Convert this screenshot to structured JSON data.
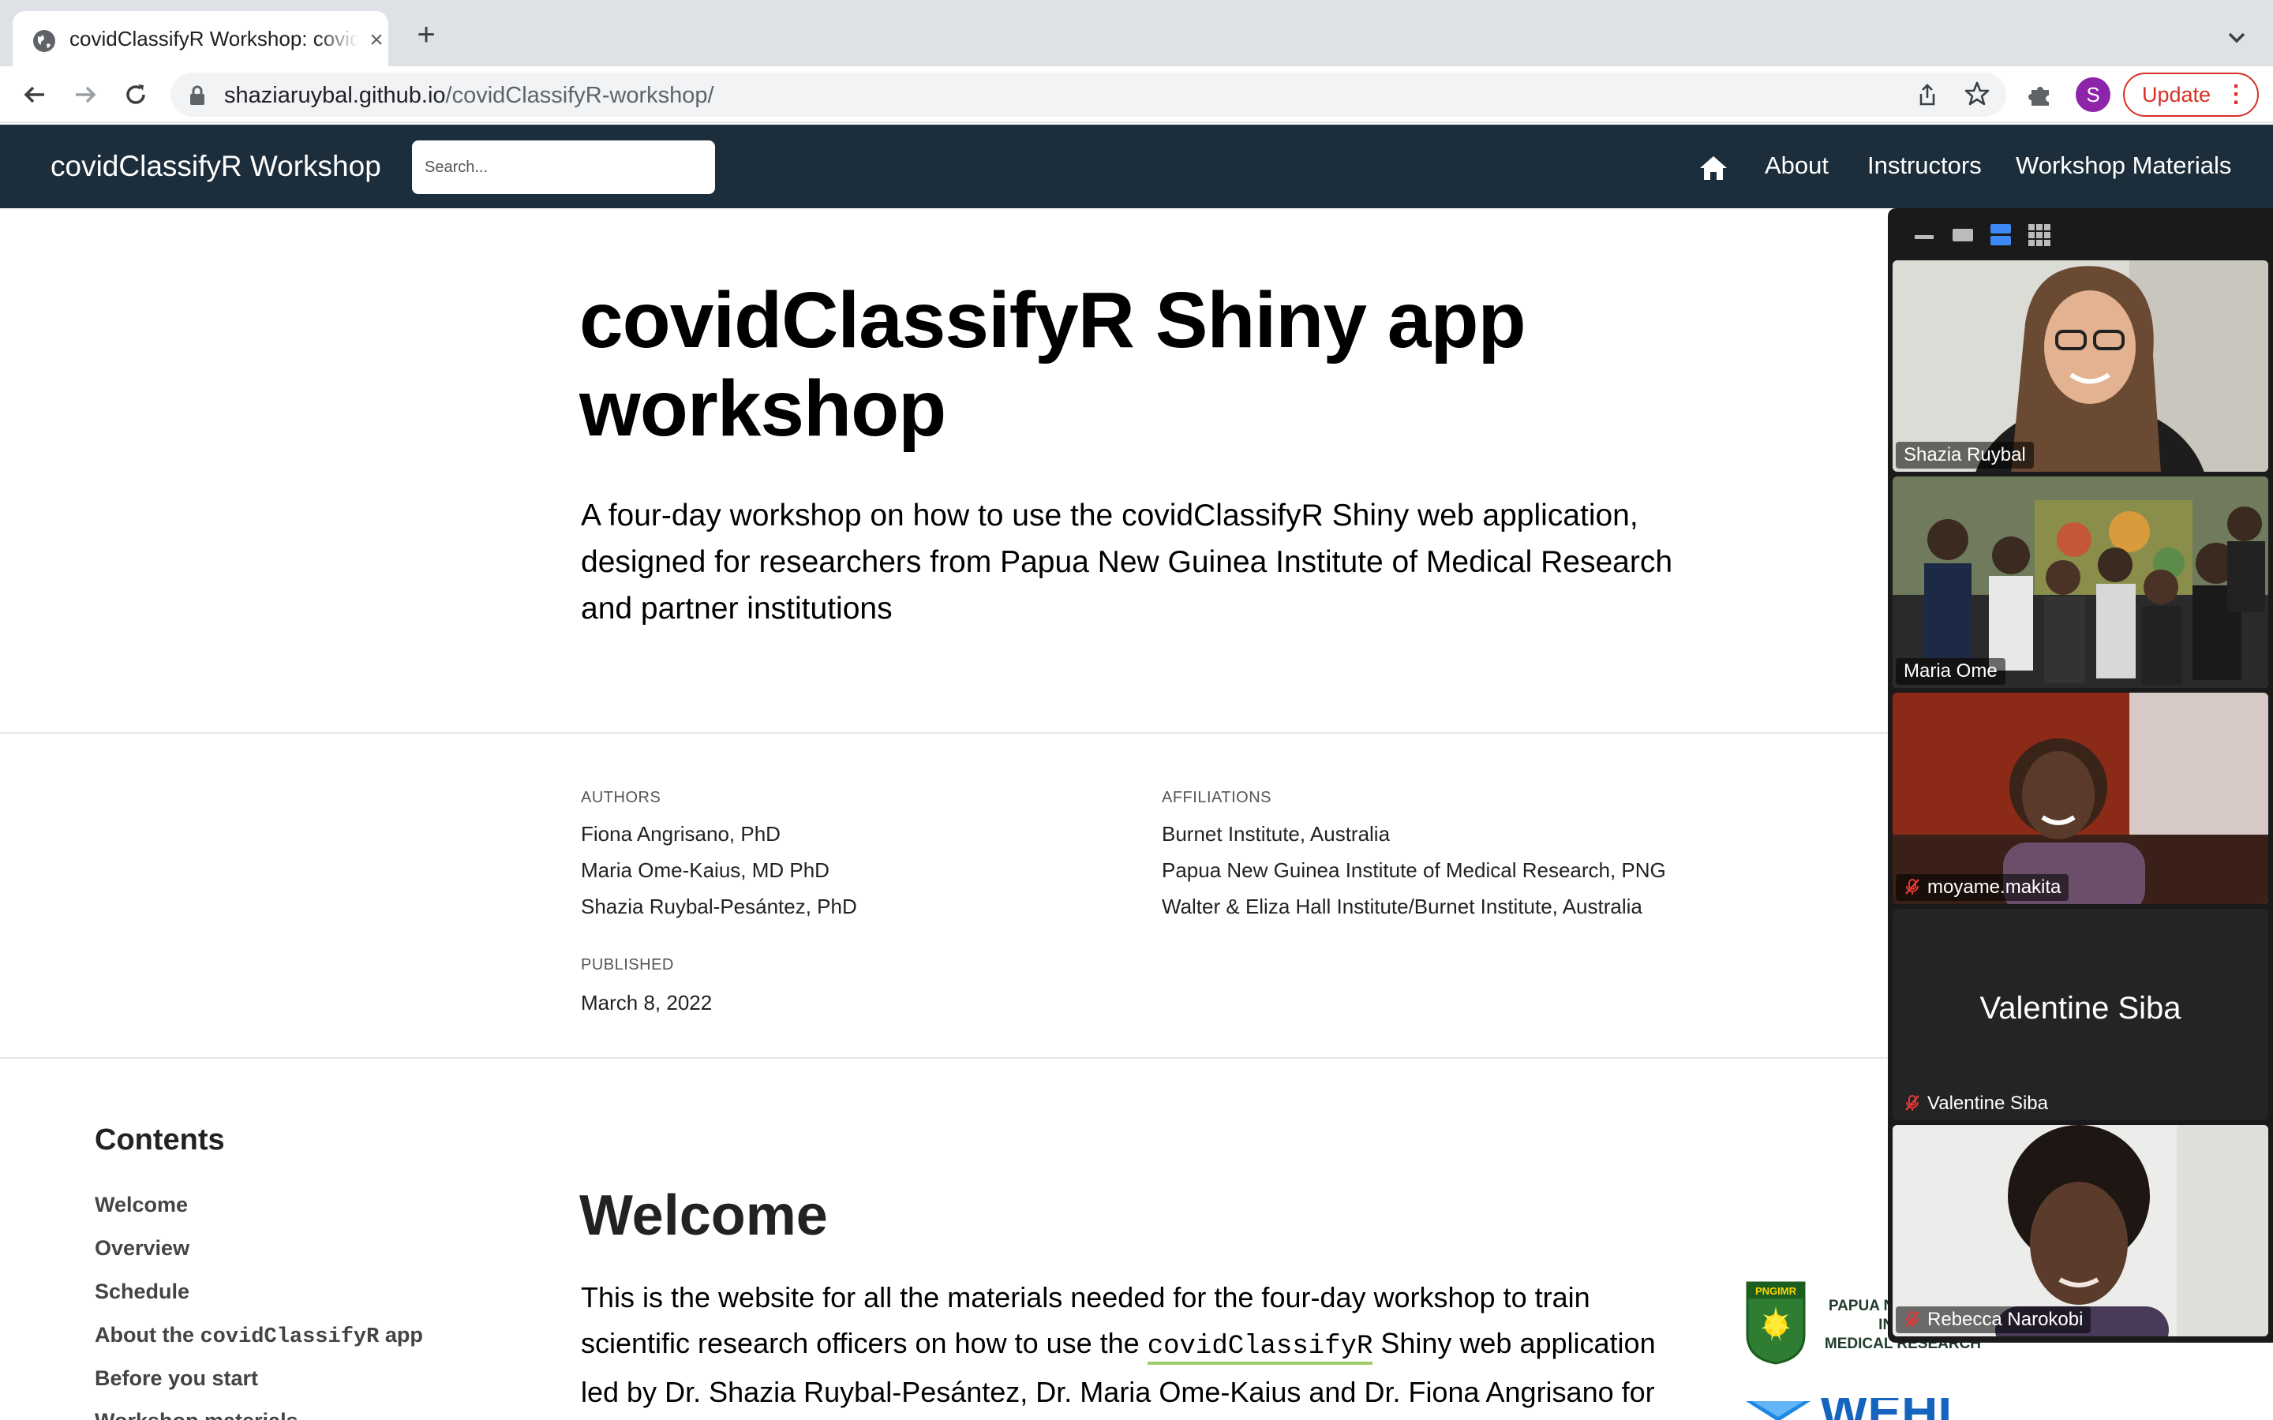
{
  "browser": {
    "tab_title": "covidClassifyR Workshop: covidClassifyR Shiny app workshop",
    "url_host": "shaziaruybal.github.io",
    "url_path": "/covidClassifyR-workshop/",
    "profile_initial": "S",
    "update_label": "Update",
    "new_tab_label": "+",
    "close_tab_label": "×"
  },
  "site": {
    "brand": "covidClassifyR Workshop",
    "search_placeholder": "Search...",
    "nav": {
      "about": "About",
      "instructors": "Instructors",
      "materials": "Workshop Materials"
    }
  },
  "article": {
    "title": "covidClassifyR Shiny app workshop",
    "description": "A four-day workshop on how to use the covidClassifyR Shiny web application, designed for researchers from Papua New Guinea Institute of Medical Research and partner institutions",
    "authors_label": "AUTHORS",
    "authors": [
      "Fiona Angrisano, PhD",
      "Maria Ome-Kaius, MD PhD",
      "Shazia Ruybal-Pesántez, PhD"
    ],
    "affiliations_label": "AFFILIATIONS",
    "affiliations": [
      "Burnet Institute, Australia",
      "Papua New Guinea Institute of Medical Research, PNG",
      "Walter & Eliza Hall Institute/Burnet Institute, Australia"
    ],
    "published_label": "PUBLISHED",
    "published": "March 8, 2022"
  },
  "toc": {
    "title": "Contents",
    "items": {
      "welcome": "Welcome",
      "overview": "Overview",
      "schedule": "Schedule",
      "about_prefix": "About the ",
      "about_code": "covidClassifyR",
      "about_suffix": " app",
      "before": "Before you start",
      "materials": "Workshop materials"
    }
  },
  "welcome": {
    "heading": "Welcome",
    "text_1": "This is the website for all the materials needed for the four-day workshop to train scientific research officers on how to use the ",
    "code": "covidClassifyR",
    "text_2": " Shiny web application led by Dr. Shazia Ruybal-Pesántez, Dr. Maria Ome-Kaius and Dr. Fiona Angrisano for researchers"
  },
  "logos": {
    "pngimr_badge": "PNGIMR",
    "pngimr_lines": [
      "PAPUA NEW GUINEA",
      "INSTITUTE OF",
      "MEDICAL RESEARCH"
    ],
    "wehi": "WEHI"
  },
  "video_call": {
    "participants": [
      {
        "name": "Shazia Ruybal",
        "muted": false,
        "speaking": false,
        "video": true
      },
      {
        "name": "Maria Ome",
        "muted": false,
        "speaking": true,
        "video": true
      },
      {
        "name": "moyame.makita",
        "muted": true,
        "speaking": false,
        "video": true
      },
      {
        "name": "Valentine Siba",
        "muted": true,
        "speaking": false,
        "video": false
      },
      {
        "name": "Rebecca Narokobi",
        "muted": true,
        "speaking": false,
        "video": true
      }
    ],
    "speaking_color": "#39c04a"
  },
  "colors": {
    "navbar": "#1c2e3b",
    "update_red": "#d93025",
    "code_underline": "#9ccc65"
  },
  "icons": [
    "globe-icon",
    "back-arrow-icon",
    "forward-arrow-icon",
    "reload-icon",
    "lock-icon",
    "share-icon",
    "star-icon",
    "puzzle-icon",
    "home-icon",
    "mic-muted-icon"
  ]
}
